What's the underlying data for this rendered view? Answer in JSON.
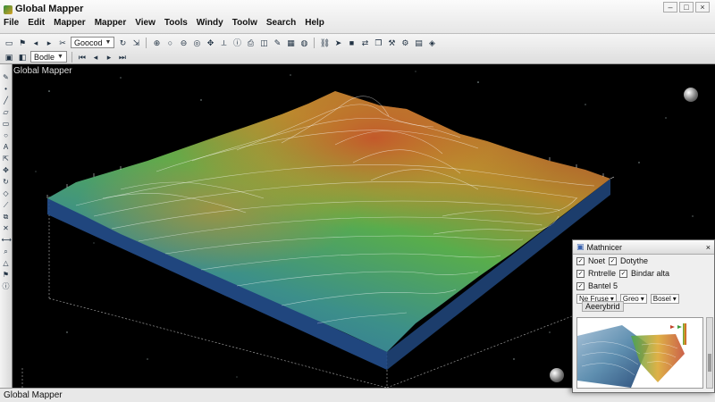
{
  "window": {
    "title": "Global Mapper",
    "controls": [
      "–",
      "□",
      "×"
    ]
  },
  "menu": [
    "File",
    "Edit",
    "Mapper",
    "Mapper",
    "View",
    "Tools",
    "Windy",
    "Toolw",
    "Search",
    "Help"
  ],
  "toolbar": {
    "row1_select": "Goocod",
    "row2_select": "Bodle"
  },
  "view_caption": "Global Mapper",
  "status_text": "Global Mapper",
  "panel": {
    "title": "Mathnicer",
    "row1_label": "Noet",
    "row1_field": "Dotythe",
    "row2_label": "Rntrelle",
    "row2_field": "Bindar alta",
    "row3_label": "Bantel 5",
    "sel1": "Ne Fruse",
    "sel2": "Greo",
    "sel3": "Bosel",
    "thumb_label": "Aeerybrid"
  },
  "colors": {
    "terrain_low": "#2f5fa8",
    "terrain_mid": "#4ea84e",
    "terrain_high": "#b3562a",
    "background": "#000000"
  },
  "icons": {
    "nav_ball": "navigation-sphere-icon",
    "app": "global-mapper-icon"
  }
}
